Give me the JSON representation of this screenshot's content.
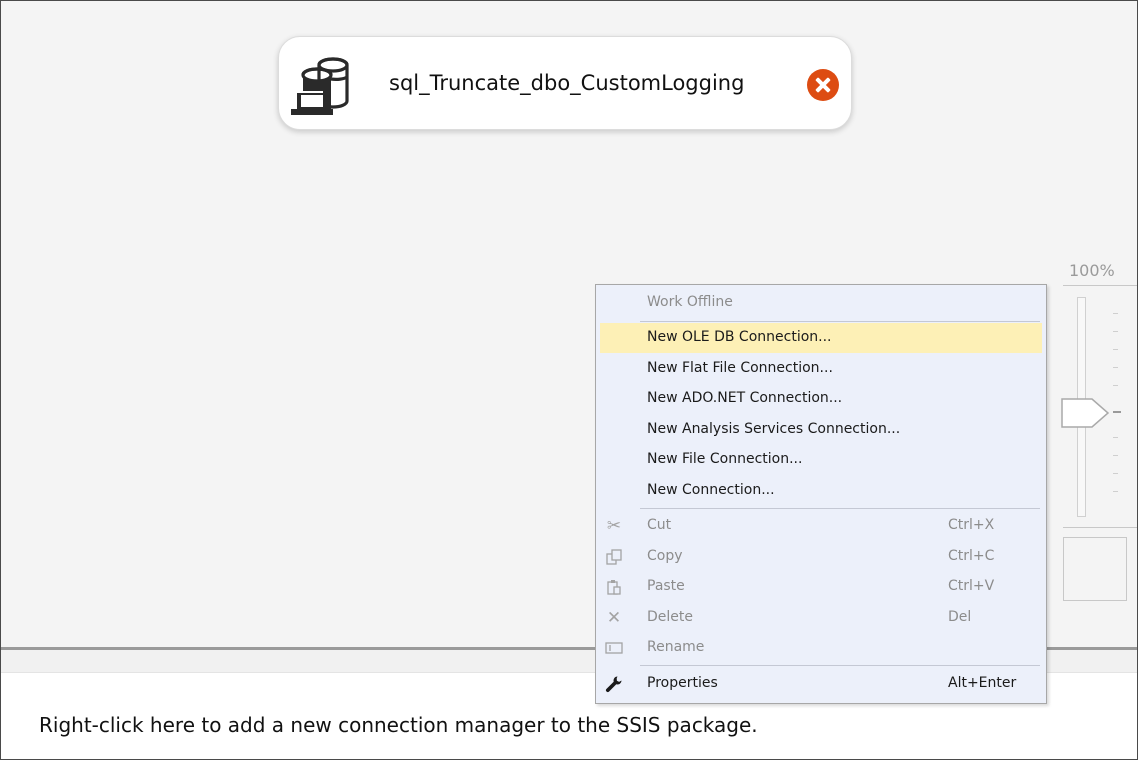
{
  "task": {
    "label": "sql_Truncate_dbo_CustomLogging",
    "icon": "execute-sql-task-icon",
    "status": "error"
  },
  "zoom": {
    "label": "100%",
    "level_percent": 100
  },
  "context_menu": {
    "items": [
      {
        "label": "Work Offline",
        "shortcut": "",
        "icon": "",
        "enabled": false,
        "highlighted": false
      },
      {
        "label": "New OLE DB Connection...",
        "shortcut": "",
        "icon": "",
        "enabled": true,
        "highlighted": true
      },
      {
        "label": "New Flat File Connection...",
        "shortcut": "",
        "icon": "",
        "enabled": true,
        "highlighted": false
      },
      {
        "label": "New ADO.NET Connection...",
        "shortcut": "",
        "icon": "",
        "enabled": true,
        "highlighted": false
      },
      {
        "label": "New Analysis Services Connection...",
        "shortcut": "",
        "icon": "",
        "enabled": true,
        "highlighted": false
      },
      {
        "label": "New File Connection...",
        "shortcut": "",
        "icon": "",
        "enabled": true,
        "highlighted": false
      },
      {
        "label": "New Connection...",
        "shortcut": "",
        "icon": "",
        "enabled": true,
        "highlighted": false
      },
      {
        "label": "Cut",
        "shortcut": "Ctrl+X",
        "icon": "scissors-icon",
        "enabled": false,
        "highlighted": false
      },
      {
        "label": "Copy",
        "shortcut": "Ctrl+C",
        "icon": "copy-icon",
        "enabled": false,
        "highlighted": false
      },
      {
        "label": "Paste",
        "shortcut": "Ctrl+V",
        "icon": "paste-icon",
        "enabled": false,
        "highlighted": false
      },
      {
        "label": "Delete",
        "shortcut": "Del",
        "icon": "delete-icon",
        "enabled": false,
        "highlighted": false
      },
      {
        "label": "Rename",
        "shortcut": "",
        "icon": "rename-icon",
        "enabled": false,
        "highlighted": false
      },
      {
        "label": "Properties",
        "shortcut": "Alt+Enter",
        "icon": "wrench-icon",
        "enabled": true,
        "highlighted": false
      }
    ]
  },
  "connection_managers": {
    "hint": "Right-click here to add a new connection manager to the SSIS package."
  },
  "colors": {
    "error": "#dd4c12",
    "highlight": "#fdf0b6",
    "menu_background": "#ecf0fa"
  }
}
